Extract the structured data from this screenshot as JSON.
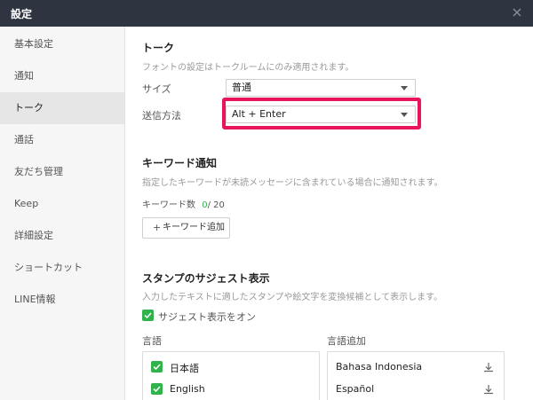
{
  "window": {
    "title": "設定"
  },
  "sidebar": {
    "items": [
      {
        "label": "基本設定"
      },
      {
        "label": "通知"
      },
      {
        "label": "トーク"
      },
      {
        "label": "通話"
      },
      {
        "label": "友だち管理"
      },
      {
        "label": "Keep"
      },
      {
        "label": "詳細設定"
      },
      {
        "label": "ショートカット"
      },
      {
        "label": "LINE情報"
      }
    ],
    "active_index": 2
  },
  "talk": {
    "title": "トーク",
    "description": "フォントの設定はトークルームにのみ適用されます。",
    "size_label": "サイズ",
    "size_value": "普通",
    "send_label": "送信方法",
    "send_value": "Alt + Enter"
  },
  "keyword": {
    "title": "キーワード通知",
    "description": "指定したキーワードが未読メッセージに含まれている場合に通知されます。",
    "count_label": "キーワード数",
    "count_current": "0",
    "count_max": "/ 20",
    "add_button": "キーワード追加",
    "add_icon": "+"
  },
  "stamp": {
    "title": "スタンプのサジェスト表示",
    "description": "入力したテキストに適したスタンプや絵文字を変換候補として表示します。",
    "checkbox_label": "サジェスト表示をオン",
    "checkbox_checked": true,
    "languages_label": "言語",
    "add_languages_label": "言語追加",
    "languages": [
      {
        "name": "日本語",
        "checked": true
      },
      {
        "name": "English",
        "checked": true
      }
    ],
    "available_languages": [
      {
        "name": "Bahasa Indonesia"
      },
      {
        "name": "Español"
      }
    ]
  },
  "colors": {
    "titlebar": "#2e3440",
    "highlight": "#e8145c",
    "check": "#2fb34a",
    "count_accent": "#2fb34a"
  }
}
